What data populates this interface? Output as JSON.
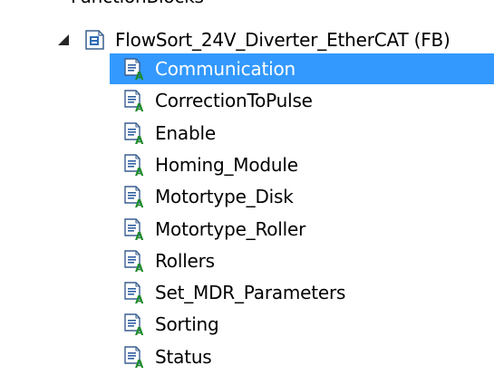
{
  "tree": {
    "parent_folder": {
      "label": "FunctionBlocks"
    },
    "function_block": {
      "label": "FlowSort_24V_Diverter_EtherCAT (FB)"
    },
    "items": [
      {
        "label": "Communication",
        "selected": true
      },
      {
        "label": "CorrectionToPulse",
        "selected": false
      },
      {
        "label": "Enable",
        "selected": false
      },
      {
        "label": "Homing_Module",
        "selected": false
      },
      {
        "label": "Motortype_Disk",
        "selected": false
      },
      {
        "label": "Motortype_Roller",
        "selected": false
      },
      {
        "label": "Rollers",
        "selected": false
      },
      {
        "label": "Set_MDR_Parameters",
        "selected": false
      },
      {
        "label": "Sorting",
        "selected": false
      },
      {
        "label": "Status",
        "selected": false
      }
    ]
  },
  "colors": {
    "selection": "#3399ff",
    "selection_text": "#ffffff",
    "text": "#000000"
  }
}
